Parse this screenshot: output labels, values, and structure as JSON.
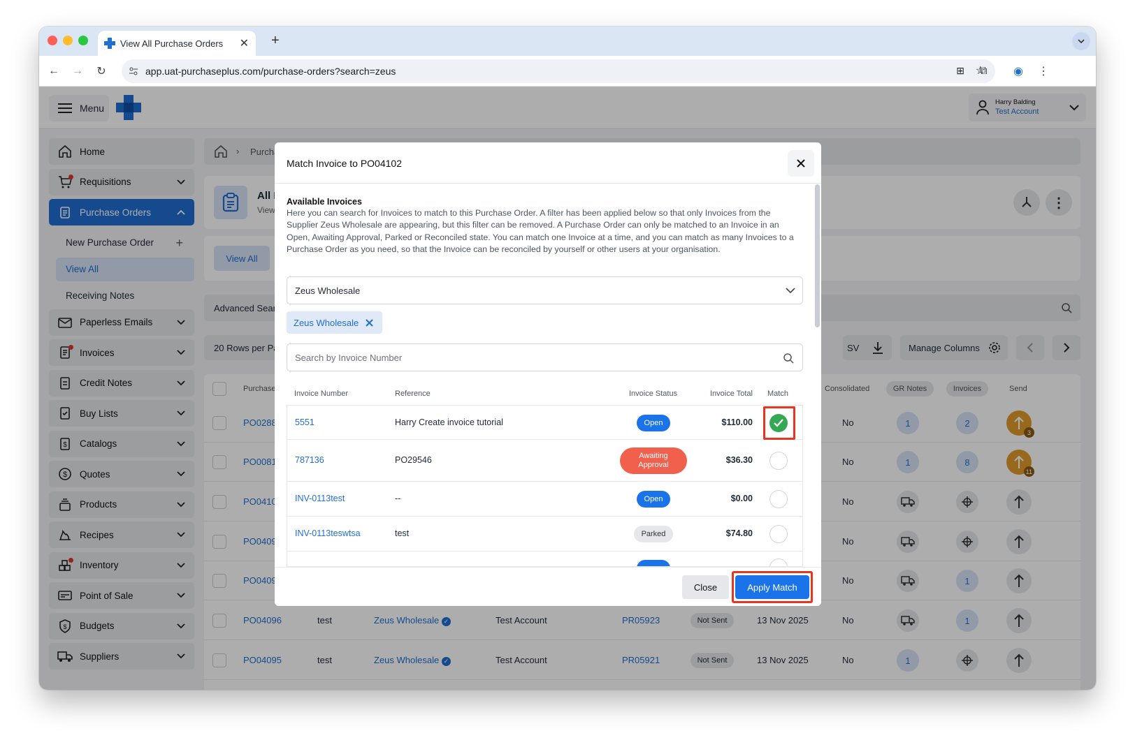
{
  "browser": {
    "tab_title": "View All Purchase Orders",
    "url": "app.uat-purchaseplus.com/purchase-orders?search=zeus"
  },
  "header": {
    "menu_label": "Menu",
    "user_name": "Harry Balding",
    "user_account": "Test Account"
  },
  "sidebar": {
    "items": [
      {
        "label": "Home",
        "icon": "home-icon"
      },
      {
        "label": "Requisitions",
        "icon": "cart-icon"
      },
      {
        "label": "Purchase Orders",
        "icon": "clipboard-icon"
      },
      {
        "label": "Paperless Emails",
        "icon": "mail-icon"
      },
      {
        "label": "Invoices",
        "icon": "invoice-icon"
      },
      {
        "label": "Credit Notes",
        "icon": "document-icon"
      },
      {
        "label": "Buy Lists",
        "icon": "checklist-icon"
      },
      {
        "label": "Catalogs",
        "icon": "dollar-doc-icon"
      },
      {
        "label": "Quotes",
        "icon": "dollar-circle-icon"
      },
      {
        "label": "Products",
        "icon": "box-stack-icon"
      },
      {
        "label": "Recipes",
        "icon": "flame-icon"
      },
      {
        "label": "Inventory",
        "icon": "cubes-icon"
      },
      {
        "label": "Point of Sale",
        "icon": "card-icon"
      },
      {
        "label": "Budgets",
        "icon": "shield-dollar-icon"
      },
      {
        "label": "Suppliers",
        "icon": "truck-icon"
      }
    ],
    "sub_items": [
      "New Purchase Order",
      "View All",
      "Receiving Notes"
    ]
  },
  "main": {
    "breadcrumb_partial": "Purcha",
    "page_title_partial": "All P",
    "page_sub_partial": "View",
    "view_all_tab": "View All",
    "advanced_search_partial": "Advanced Sear",
    "rows_per_page_partial": "20 Rows per Pa",
    "csv_partial": "SV",
    "manage_columns": "Manage Columns",
    "table_headers": {
      "purchase": "Purchase",
      "consolidated": "Consolidated",
      "gr_notes": "GR Notes",
      "invoices": "Invoices",
      "send": "Send"
    },
    "rows": [
      {
        "po": "PO0288",
        "ref": "",
        "supplier": "",
        "account": "",
        "pr": "",
        "status": "",
        "date": "",
        "consolidated": "No",
        "gr": "1",
        "inv": "2",
        "send_badge": "3"
      },
      {
        "po": "PO0081",
        "ref": "",
        "supplier": "",
        "account": "",
        "pr": "",
        "status": "",
        "date": "",
        "consolidated": "No",
        "gr": "1",
        "inv": "8",
        "send_badge": "11"
      },
      {
        "po": "PO0410",
        "ref": "",
        "supplier": "",
        "account": "",
        "pr": "",
        "status": "",
        "date": "",
        "consolidated": "No",
        "gr": "",
        "inv": "",
        "send_badge": ""
      },
      {
        "po": "PO0409",
        "ref": "",
        "supplier": "",
        "account": "",
        "pr": "",
        "status": "",
        "date": "",
        "consolidated": "No",
        "gr": "",
        "inv": "",
        "send_badge": ""
      },
      {
        "po": "PO0409",
        "ref": "",
        "supplier": "",
        "account": "",
        "pr": "",
        "status": "",
        "date": "",
        "consolidated": "No",
        "gr": "",
        "inv": "1",
        "send_badge": ""
      },
      {
        "po": "PO04096",
        "ref": "test",
        "supplier": "Zeus Wholesale",
        "account": "Test Account",
        "pr": "PR05923",
        "status": "Not Sent",
        "date": "13 Nov 2025",
        "consolidated": "No",
        "gr": "",
        "inv": "1",
        "send_badge": ""
      },
      {
        "po": "PO04095",
        "ref": "test",
        "supplier": "Zeus Wholesale",
        "account": "Test Account",
        "pr": "PR05921",
        "status": "Not Sent",
        "date": "13 Nov 2025",
        "consolidated": "No",
        "gr": "1",
        "inv": "",
        "send_badge": ""
      }
    ]
  },
  "modal": {
    "title": "Match Invoice to PO04102",
    "heading": "Available Invoices",
    "description": "Here you can search for Invoices to match to this Purchase Order. A filter has been applied below so that only Invoices from the Supplier Zeus Wholesale are appearing, but this filter can be removed. A Purchase Order can only be matched to an Invoice in an Open, Awaiting Approval, Parked or Reconciled state. You can match one Invoice at a time, and you can match as many Invoices to a Purchase Order as you need, so that the Invoice can be reconciled by yourself or other users at your organisation.",
    "supplier_select": "Zeus Wholesale",
    "filter_chip": "Zeus Wholesale",
    "search_placeholder": "Search by Invoice Number",
    "columns": [
      "Invoice Number",
      "Reference",
      "Invoice Status",
      "Invoice Total",
      "Match"
    ],
    "invoices": [
      {
        "number": "5551",
        "reference": "Harry Create invoice tutorial",
        "status": "Open",
        "total": "$110.00",
        "matched": true
      },
      {
        "number": "787136",
        "reference": "PO29546",
        "status": "Awaiting Approval",
        "total": "$36.30",
        "matched": false
      },
      {
        "number": "INV-0113test",
        "reference": "--",
        "status": "Open",
        "total": "$0.00",
        "matched": false
      },
      {
        "number": "INV-0113teswtsa",
        "reference": "test",
        "status": "Parked",
        "total": "$74.80",
        "matched": false
      }
    ],
    "close_label": "Close",
    "apply_label": "Apply Match"
  },
  "colors": {
    "primary": "#1f6fd1",
    "open": "#1a73e8",
    "awaiting": "#f0604d",
    "matched": "#34a853",
    "highlight": "#e8351f",
    "send": "#e09a2c"
  }
}
